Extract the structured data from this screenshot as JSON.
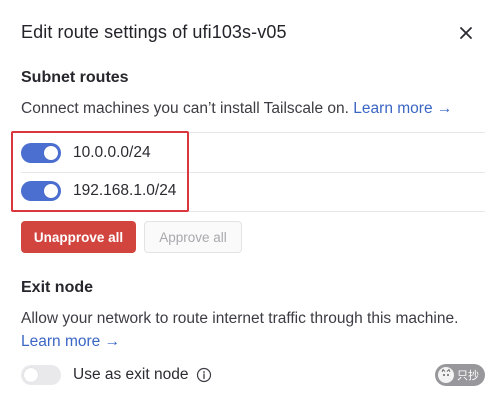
{
  "dialog": {
    "title": "Edit route settings of ufi103s-v05",
    "close_icon": "close-icon"
  },
  "subnet": {
    "heading": "Subnet routes",
    "description": "Connect machines you can’t install Tailscale on.",
    "learn_more": "Learn more →",
    "routes": [
      {
        "label": "10.0.0.0/24",
        "enabled": true
      },
      {
        "label": "192.168.1.0/24",
        "enabled": true
      }
    ],
    "unapprove_all": "Unapprove all",
    "approve_all": "Approve all"
  },
  "exit_node": {
    "heading": "Exit node",
    "description": "Allow your network to route internet traffic through this machine.",
    "learn_more": "Learn more →",
    "toggle_label": "Use as exit node",
    "enabled": false,
    "info_icon": "info-icon"
  },
  "watermark": {
    "text": "只抄",
    "icon": "cat-face-icon"
  },
  "colors": {
    "accent": "#4a6fd1",
    "danger": "#d2453e",
    "link": "#3b66c4",
    "highlight": "#d9363e"
  }
}
